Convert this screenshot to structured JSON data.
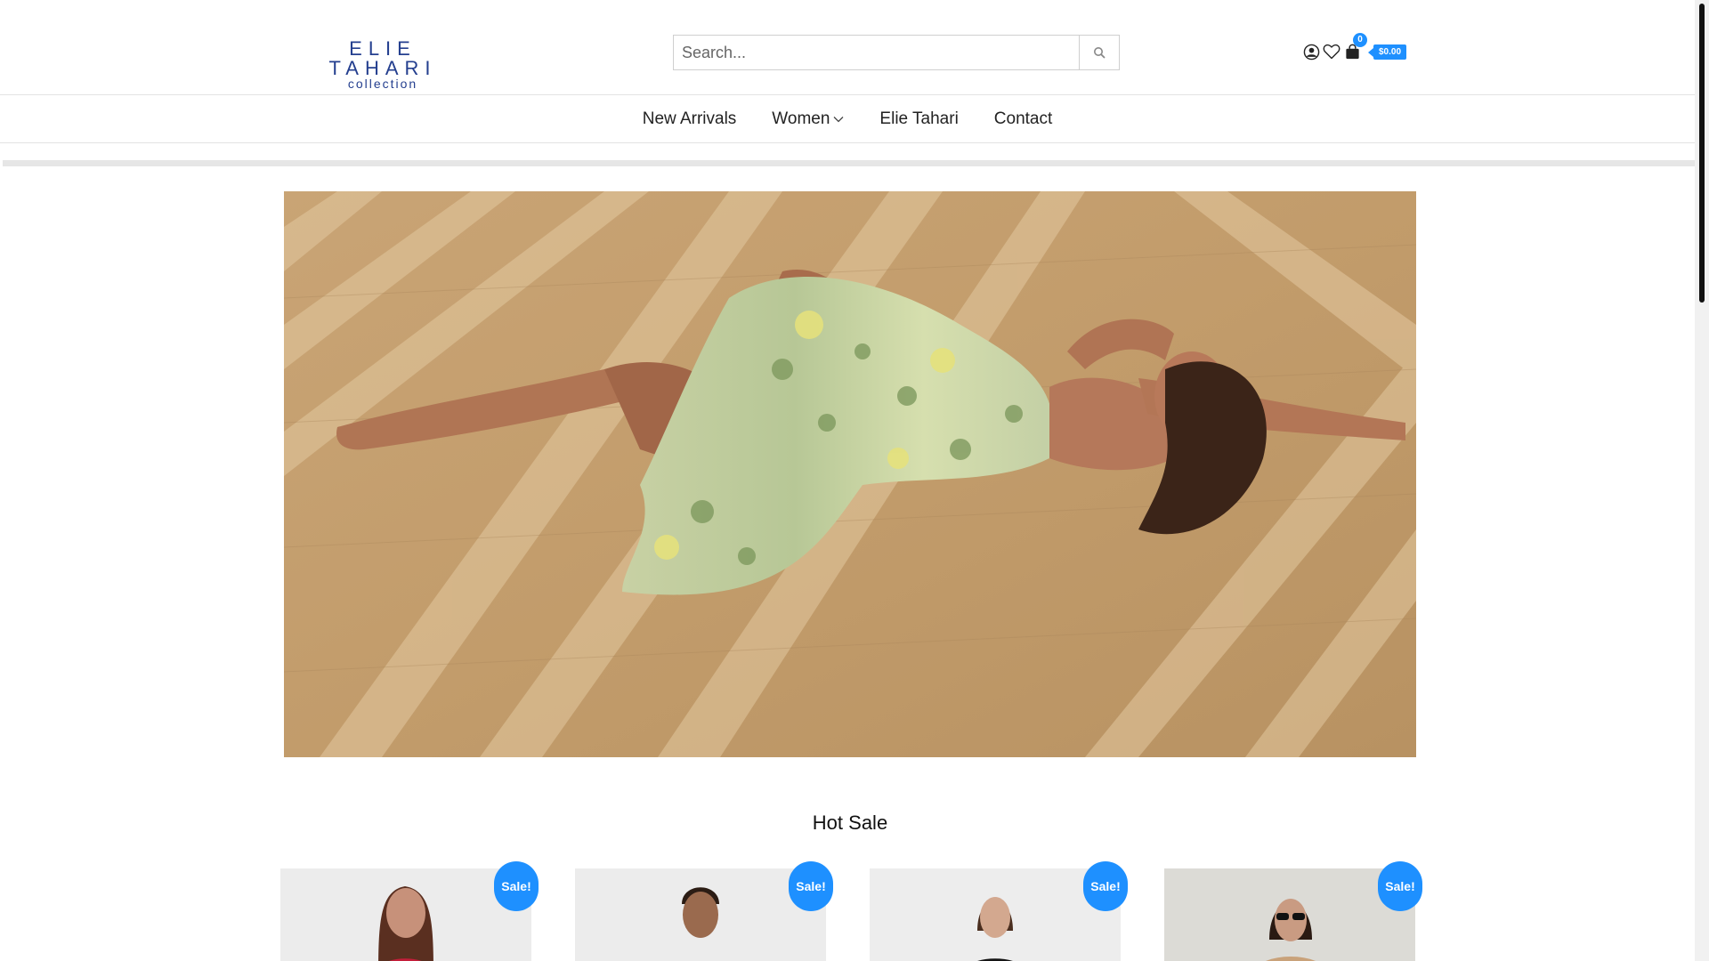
{
  "brand": {
    "logo_main": "ELIE TAHARI",
    "logo_sub": "collection",
    "accent_color": "#1e90ff",
    "logo_color": "#243f8f"
  },
  "search": {
    "placeholder": "Search...",
    "button_icon": "search-icon"
  },
  "header_icons": {
    "account": "user-circle-icon",
    "wishlist": "heart-icon",
    "cart": "shopping-bag-icon",
    "cart_count": "0",
    "cart_total": "$0.00"
  },
  "nav": {
    "items": [
      {
        "label": "New Arrivals"
      },
      {
        "label": "Women",
        "has_dropdown": true
      },
      {
        "label": "Elie Tahari"
      },
      {
        "label": "Contact"
      }
    ]
  },
  "hero": {
    "image": "hero-banner-woman-floral-dress"
  },
  "hot_sale": {
    "title": "Hot Sale",
    "products": [
      {
        "badge": "Sale!"
      },
      {
        "badge": "Sale!"
      },
      {
        "badge": "Sale!"
      },
      {
        "badge": "Sale!"
      }
    ]
  }
}
